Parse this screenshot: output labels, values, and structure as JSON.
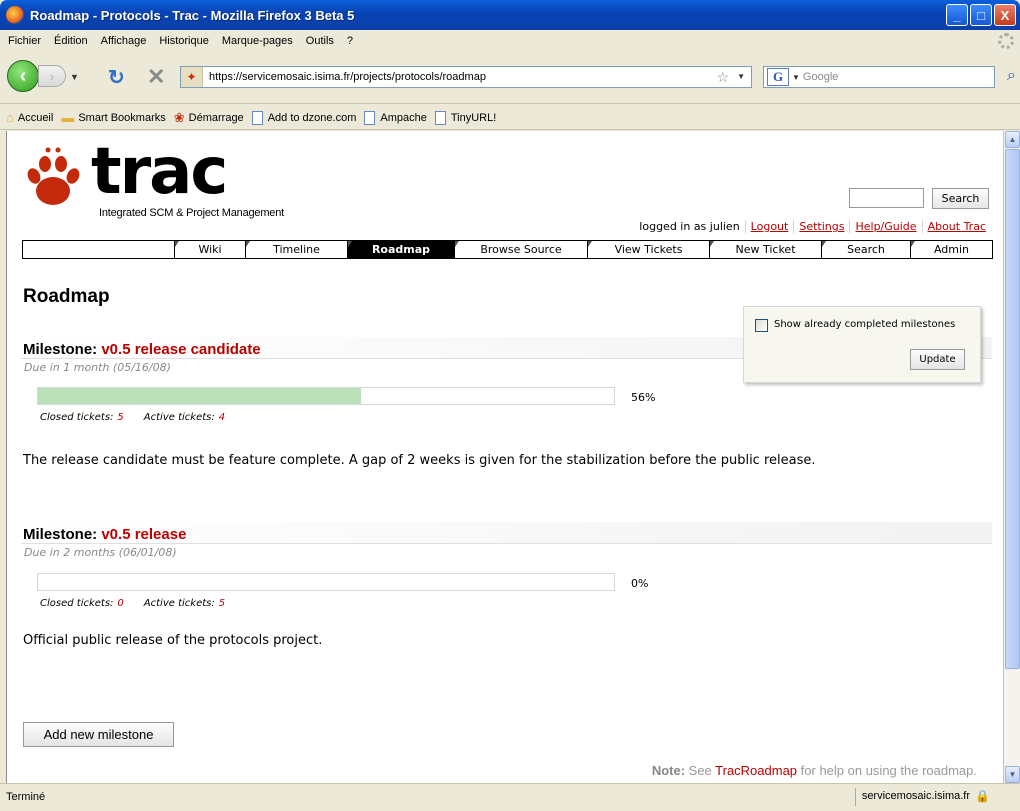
{
  "window": {
    "title": "Roadmap - Protocols - Trac - Mozilla Firefox 3 Beta 5",
    "minimize": "_",
    "maximize": "□",
    "close": "X"
  },
  "menu": [
    "Fichier",
    "Édition",
    "Affichage",
    "Historique",
    "Marque-pages",
    "Outils",
    "?"
  ],
  "nav": {
    "url": "https://servicemosaic.isima.fr/projects/protocols/roadmap",
    "search_placeholder": "Google"
  },
  "bookmarks": [
    "Accueil",
    "Smart Bookmarks",
    "Démarrage",
    "Add to dzone.com",
    "Ampache",
    "TinyURL!"
  ],
  "trac": {
    "logo_text": "trac",
    "logo_subtitle": "Integrated SCM & Project Management",
    "search_button": "Search",
    "metanav": [
      "logged in as julien",
      "Logout",
      "Settings",
      "Help/Guide",
      "About Trac"
    ],
    "mainnav": [
      "Wiki",
      "Timeline",
      "Roadmap",
      "Browse Source",
      "View Tickets",
      "New Ticket",
      "Search",
      "Admin"
    ],
    "active_tab": "Roadmap"
  },
  "page": {
    "title": "Roadmap",
    "filter_label": "Show already completed milestones",
    "update_button": "Update",
    "add_button": "Add new milestone",
    "note_prefix": "Note:",
    "note_mid": " See ",
    "note_link": "TracRoadmap",
    "note_suffix": " for help on using the roadmap."
  },
  "milestones": [
    {
      "label": "Milestone: ",
      "name": "v0.5 release candidate",
      "due": "Due in 1 month (05/16/08)",
      "progress": 0.56,
      "percent": "56%",
      "closed_label": "Closed tickets:",
      "closed": "5",
      "active_label": "Active tickets:",
      "active": "4",
      "description": "The release candidate must be feature complete. A gap of 2 weeks is given for the stabilization before the public release."
    },
    {
      "label": "Milestone: ",
      "name": "v0.5 release",
      "due": "Due in 2 months (06/01/08)",
      "progress": 0,
      "percent": "0%",
      "closed_label": "Closed tickets:",
      "closed": "0",
      "active_label": "Active tickets:",
      "active": "5",
      "description": "Official public release of the protocols project."
    }
  ],
  "status": {
    "text": "Terminé",
    "host": "servicemosaic.isima.fr"
  },
  "colors": {
    "link": "#bb0000",
    "progress_fill": "#bae0ba"
  }
}
